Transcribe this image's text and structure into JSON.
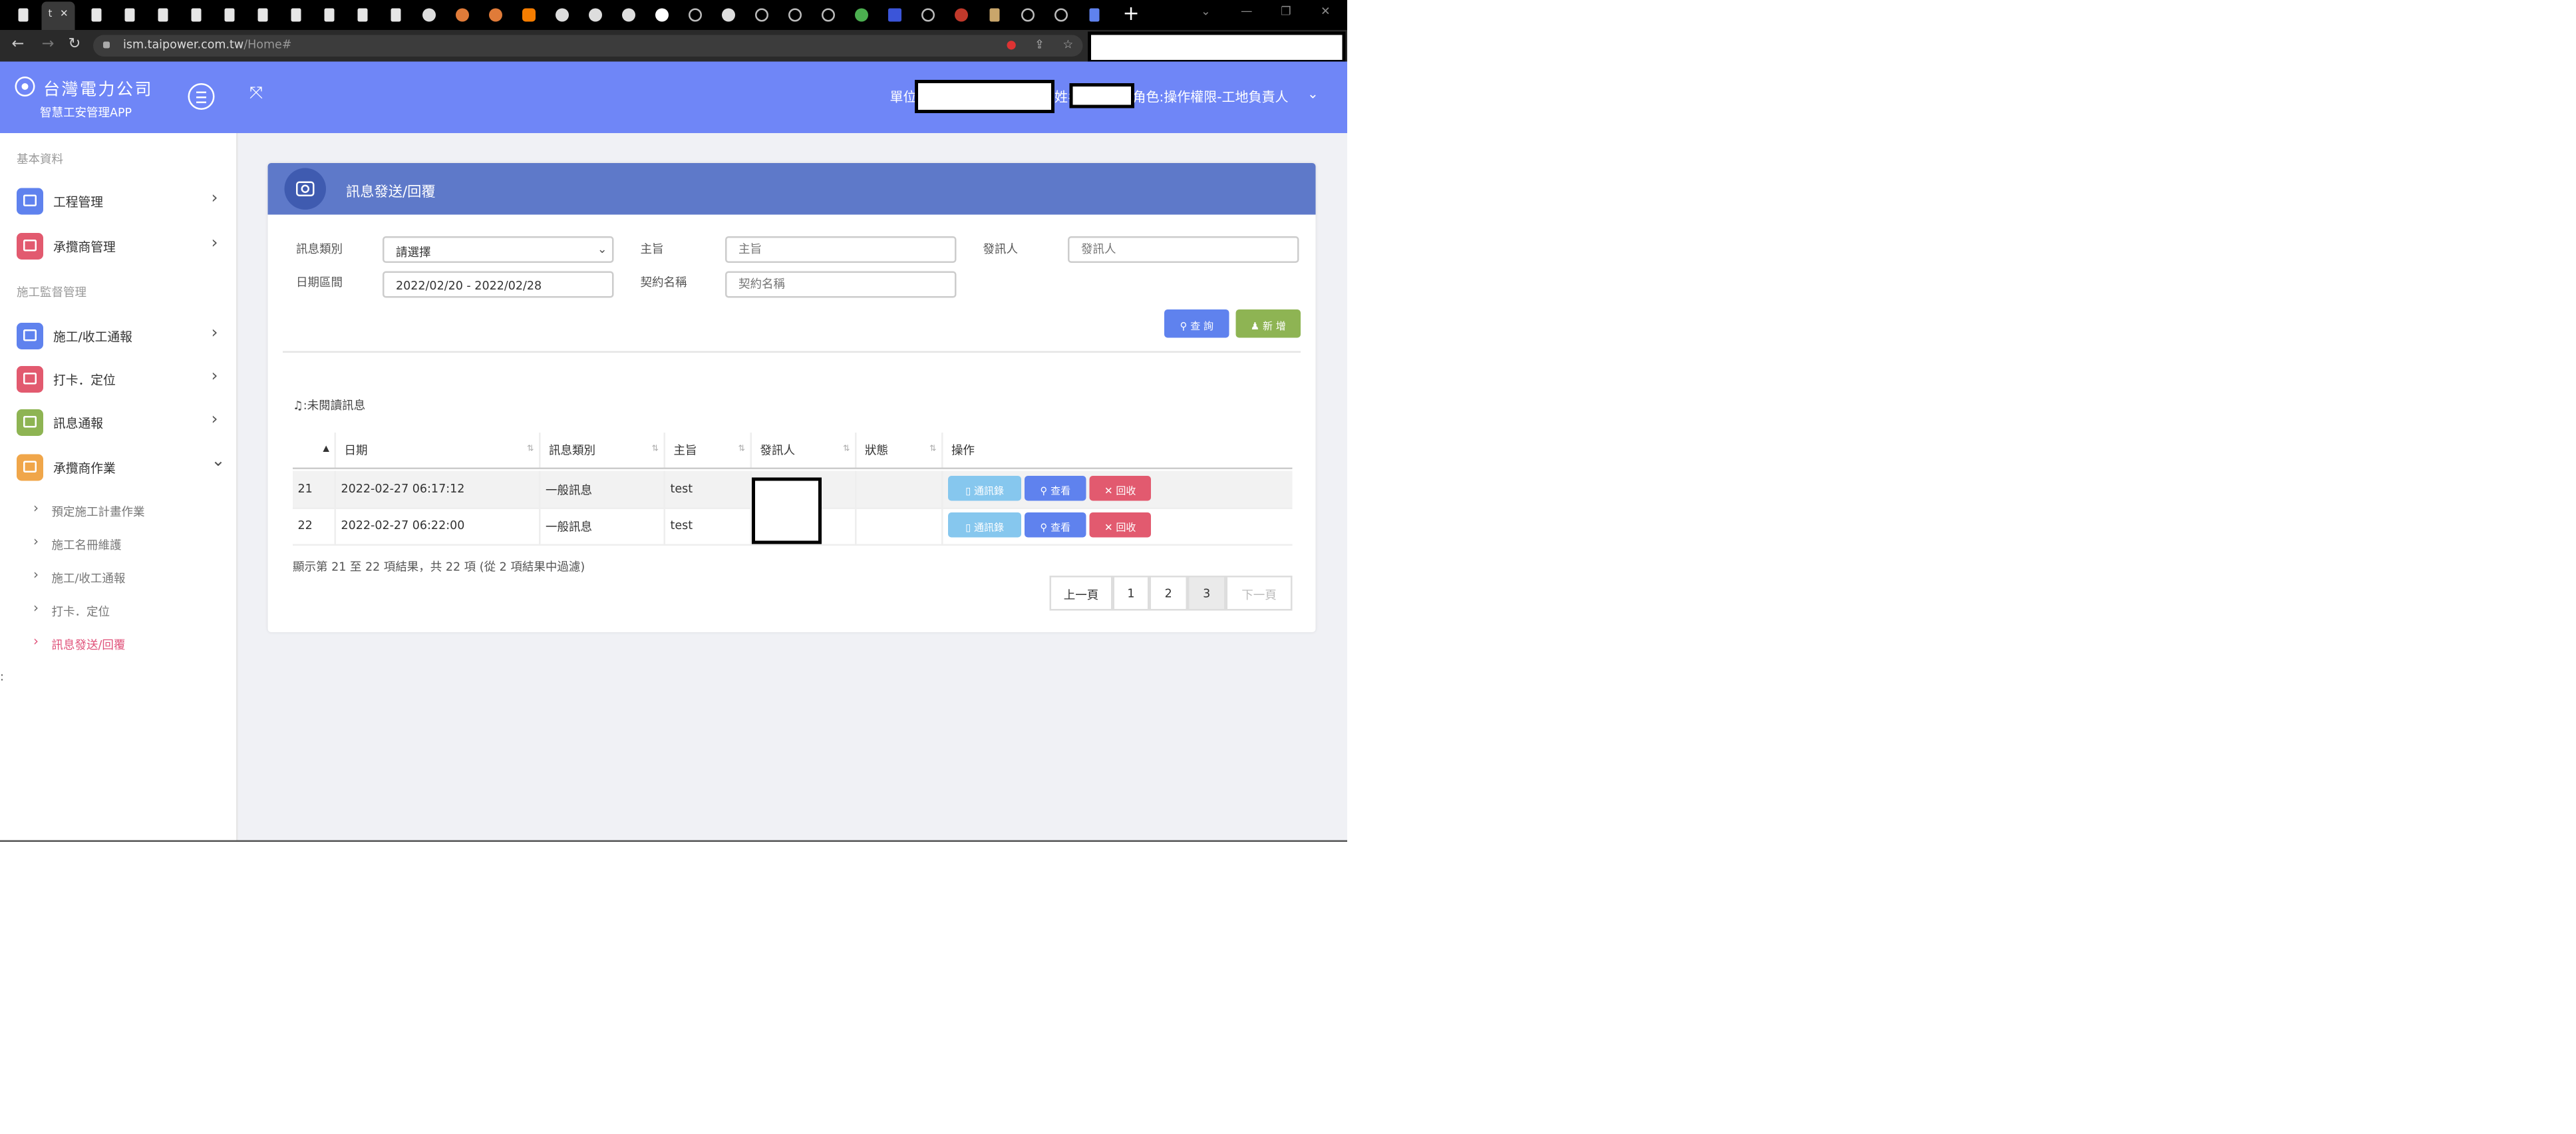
{
  "browser": {
    "active_tab_label": "t",
    "active_tab_close": "✕",
    "new_tab": "+",
    "url_host": "ism.taipower.com.tw",
    "url_path": "/Home#",
    "win_min": "—",
    "win_max": "❐",
    "win_close": "✕"
  },
  "header": {
    "brand": "台灣電力公司",
    "app_name": "智慧工安管理APP",
    "unit_label": "單位:",
    "name_label": "姓名:",
    "role_label": "角色:操作權限-工地負責人"
  },
  "sidebar": {
    "section_basic": "基本資料",
    "section_monitor": "施工監督管理",
    "items": [
      {
        "label": "工程管理",
        "color": "#5f82ee"
      },
      {
        "label": "承攬商管理",
        "color": "#e25a6f"
      },
      {
        "label": "施工/收工通報",
        "color": "#5f82ee"
      },
      {
        "label": "打卡．定位",
        "color": "#e25a6f"
      },
      {
        "label": "訊息通報",
        "color": "#8eb453"
      },
      {
        "label": "承攬商作業",
        "color": "#f0a64a"
      }
    ],
    "sub_items": [
      {
        "label": "預定施工計畫作業"
      },
      {
        "label": "施工名冊維護"
      },
      {
        "label": "施工/收工通報"
      },
      {
        "label": "打卡．定位"
      },
      {
        "label": "訊息發送/回覆"
      }
    ]
  },
  "card": {
    "title": "訊息發送/回覆",
    "filters": {
      "category_label": "訊息類別",
      "category_value": "請選擇",
      "subject_label": "主旨",
      "subject_placeholder": "主旨",
      "sender_label": "發訊人",
      "sender_placeholder": "發訊人",
      "date_label": "日期區間",
      "date_value": "2022/02/20 - 2022/02/28",
      "contract_label": "契約名稱",
      "contract_placeholder": "契約名稱"
    },
    "search_button": "查 詢",
    "add_button": "新 增",
    "unread_label": "未閱讀訊息"
  },
  "table": {
    "columns": [
      "",
      "日期",
      "訊息類別",
      "主旨",
      "發訊人",
      "狀態",
      "操作"
    ],
    "rows": [
      {
        "no": "21",
        "date": "2022-02-27 06:17:12",
        "category": "一般訊息",
        "subject": "test",
        "sender": "",
        "status": ""
      },
      {
        "no": "22",
        "date": "2022-02-27 06:22:00",
        "category": "一般訊息",
        "subject": "test",
        "sender": "",
        "status": ""
      }
    ],
    "actions": {
      "message": "通訊錄",
      "view": "查看",
      "recall": "回收"
    },
    "summary": "顯示第 21 至 22 項結果，共 22 項 (從 2 項結果中過濾)"
  },
  "pagination": {
    "prev": "上一頁",
    "pages": [
      "1",
      "2",
      "3"
    ],
    "current": "3",
    "next": "下一頁"
  }
}
